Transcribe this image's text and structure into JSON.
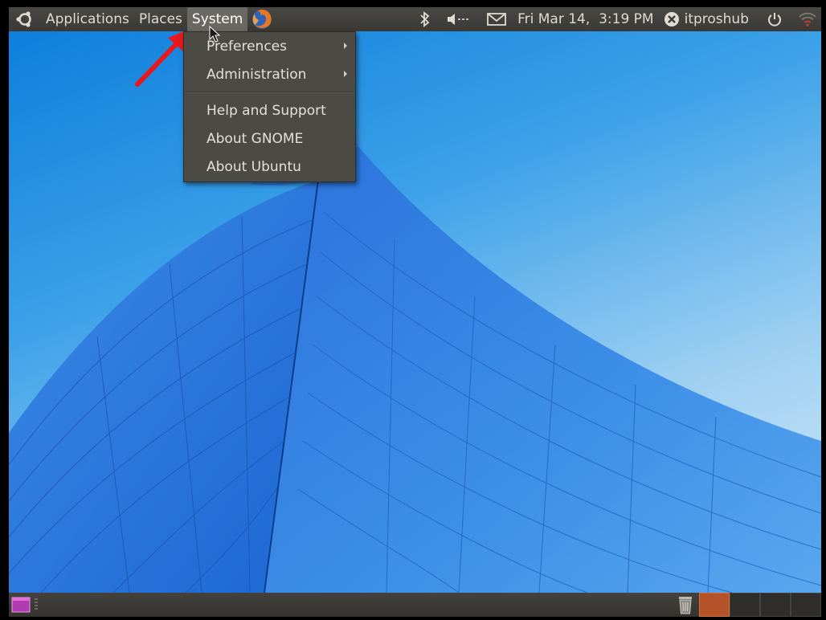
{
  "top_panel": {
    "menus": {
      "applications": "Applications",
      "places": "Places",
      "system": "System"
    },
    "clock": "Fri Mar 14,  3:19 PM",
    "username": "itproshub"
  },
  "system_menu": {
    "items": [
      {
        "label": "Preferences",
        "has_submenu": true
      },
      {
        "label": "Administration",
        "has_submenu": true
      },
      {
        "label": "Help and Support",
        "has_submenu": false
      },
      {
        "label": "About GNOME",
        "has_submenu": false
      },
      {
        "label": "About Ubuntu",
        "has_submenu": false
      }
    ]
  },
  "colors": {
    "panel": "#3a3936",
    "menu_bg": "#4c4a45",
    "annotation_arrow": "#e8191d",
    "taskbar_accent": "#b4532a"
  },
  "icons": {
    "ubuntu_logo": "ubuntu-logo-icon",
    "firefox": "firefox-icon",
    "bluetooth": "bluetooth-icon",
    "volume": "volume-muted-icon",
    "mail": "mail-icon",
    "user_status": "user-status-icon",
    "power": "power-icon",
    "wifi": "wifi-icon",
    "show_desktop": "show-desktop-icon",
    "trash": "trash-icon"
  }
}
